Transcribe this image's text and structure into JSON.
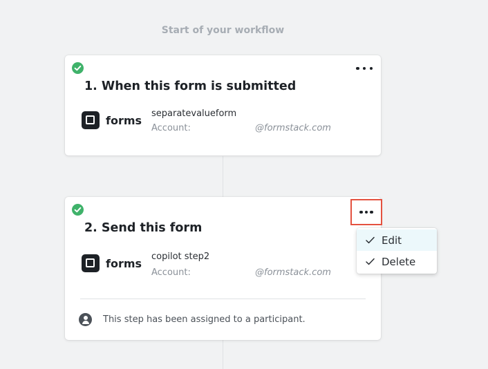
{
  "workflow": {
    "header": "Start of your workflow"
  },
  "steps": [
    {
      "title": "1. When this form is submitted",
      "app_name": "forms",
      "form_name": "separatevalueform",
      "account_label": "Account:",
      "account_value": "@formstack.com",
      "status": "complete"
    },
    {
      "title": "2. Send this form",
      "app_name": "forms",
      "form_name": "copilot step2",
      "account_label": "Account:",
      "account_value": "@formstack.com",
      "status": "complete",
      "participant_note": "This step has been assigned to a participant."
    }
  ],
  "menu": {
    "items": [
      {
        "label": "Edit",
        "highlighted": true
      },
      {
        "label": "Delete",
        "highlighted": false
      }
    ]
  },
  "colors": {
    "success": "#3fb26a",
    "active_outline": "#e4513f",
    "menu_highlight": "#ecf8fb",
    "text_primary": "#1d2126",
    "text_muted": "#8a9098"
  },
  "icons": {
    "status": "check-circle-icon",
    "more": "more-horizontal-icon",
    "app": "formstack-forms-icon",
    "participant": "person-icon",
    "menu_check": "check-icon"
  }
}
